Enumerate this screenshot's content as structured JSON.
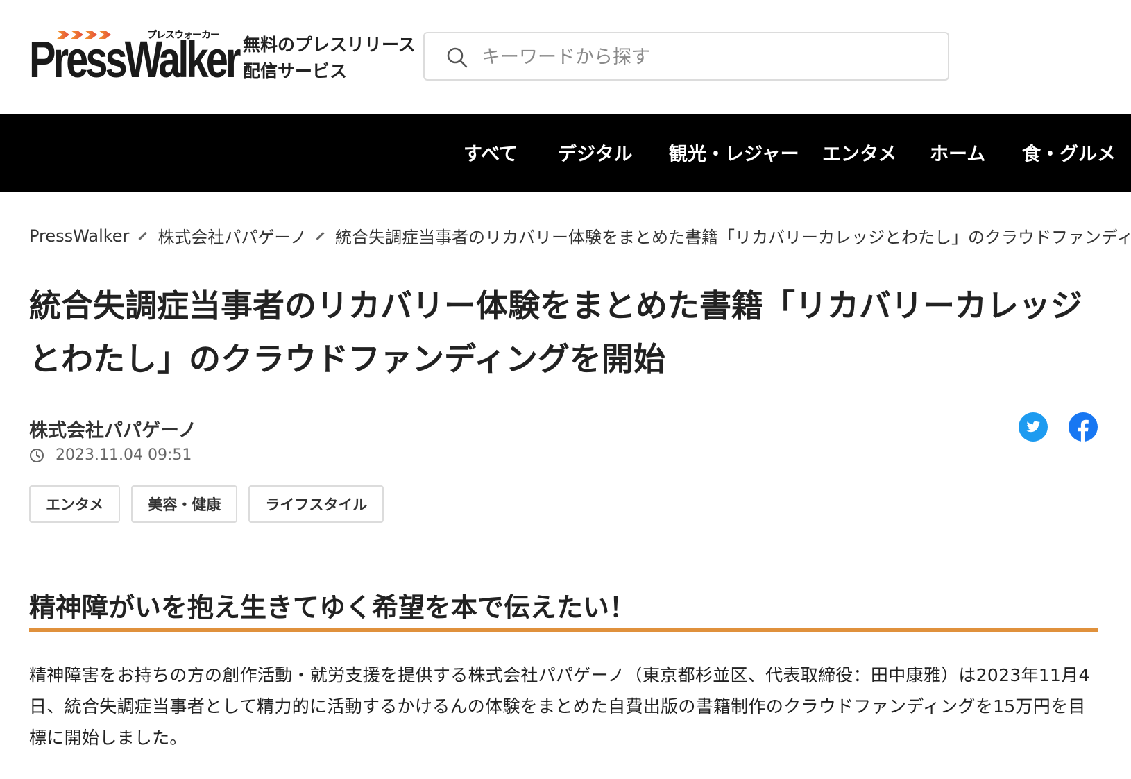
{
  "header": {
    "logo_text": "PressWalker",
    "logo_kana": "プレスウォーカー",
    "tagline_line1": "無料のプレスリリース",
    "tagline_line2": "配信サービス",
    "search_placeholder": "キーワードから探す"
  },
  "nav": {
    "items": [
      "すべて",
      "デジタル",
      "観光・レジャー",
      "エンタメ",
      "ホーム",
      "食・グルメ"
    ]
  },
  "breadcrumb": {
    "items": [
      "PressWalker",
      "株式会社パパゲーノ",
      "統合失調症当事者のリカバリー体験をまとめた書籍「リカバリーカレッジとわたし」のクラウドファンディング"
    ]
  },
  "article": {
    "title": "統合失調症当事者のリカバリー体験をまとめた書籍「リカバリーカレッジとわたし」のクラウドファンディングを開始",
    "company": "株式会社パパゲーノ",
    "date": "2023.11.04 09:51",
    "tags": [
      "エンタメ",
      "美容・健康",
      "ライフスタイル"
    ],
    "subheading": "精神障がいを抱え生きてゆく希望を本で伝えたい！",
    "body": "精神障害をお持ちの方の創作活動・就労支援を提供する株式会社パパゲーノ（東京都杉並区、代表取締役：田中康雅）は2023年11月4日、統合失調症当事者として精力的に活動するかけるんの体験をまとめた自費出版の書籍制作のクラウドファンディングを15万円を目標に開始しました。"
  },
  "share": {
    "icons": [
      "twitter-icon",
      "facebook-icon"
    ]
  },
  "colors": {
    "nav_background": "#000000",
    "accent_rule": "#e0913c",
    "twitter": "#1d9bf0",
    "facebook": "#1877f2"
  }
}
